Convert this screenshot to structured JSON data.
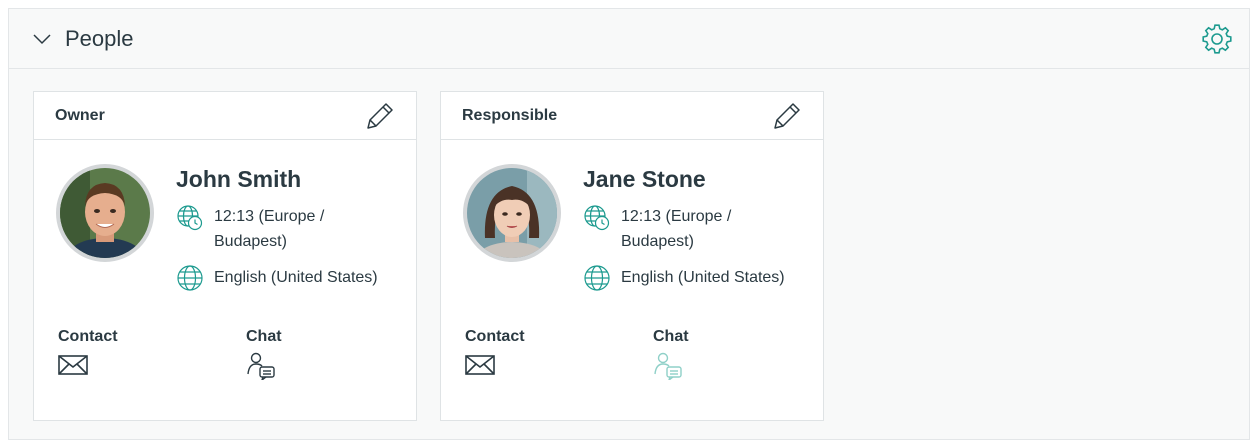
{
  "widget": {
    "title": "People",
    "collapse_icon": "chevron-down-icon",
    "settings_icon": "gear-icon"
  },
  "cards": [
    {
      "role": "Owner",
      "name": "John Smith",
      "timezone": "12:13 (Europe / Budapest)",
      "language": "English (United States)",
      "contact_label": "Contact",
      "chat_label": "Chat",
      "chat_enabled": true
    },
    {
      "role": "Responsible",
      "name": "Jane Stone",
      "timezone": "12:13 (Europe / Budapest)",
      "language": "English (United States)",
      "contact_label": "Contact",
      "chat_label": "Chat",
      "chat_enabled": false
    }
  ],
  "colors": {
    "accent": "#1c9a8f",
    "text": "#2b3a42",
    "border": "#dfe3e5",
    "chat_disabled": "#8fd0c8"
  }
}
